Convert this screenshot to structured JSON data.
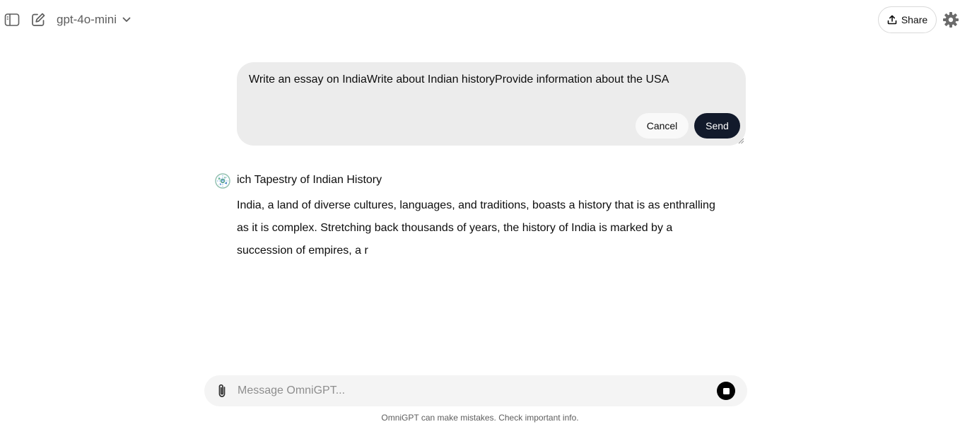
{
  "header": {
    "model_name": "gpt-4o-mini",
    "share_label": "Share"
  },
  "edit": {
    "text": "Write an essay on IndiaWrite about Indian historyProvide information about the USA",
    "cancel_label": "Cancel",
    "send_label": "Send"
  },
  "response": {
    "heading": "ich Tapestry of Indian History",
    "lines": [
      "India, a land of diverse cultures, languages, and traditions, boasts a history that is as enthralling",
      "as it is complex. Stretching back thousands of years, the history of India is marked by a",
      "succession of empires, a r"
    ]
  },
  "composer": {
    "placeholder": "Message OmniGPT..."
  },
  "footer": {
    "disclaimer": "OmniGPT can make mistakes. Check important info."
  },
  "icons": {
    "sidebar_toggle": "sidebar-toggle-icon",
    "new_chat": "new-chat-icon",
    "chevron": "chevron-down-icon",
    "share": "share-upload-icon",
    "settings": "gear-icon",
    "avatar": "assistant-avatar-icon",
    "attach": "paperclip-icon",
    "stop": "stop-icon"
  },
  "colors": {
    "send_button": "#121a2b",
    "edit_box": "#ececec",
    "composer": "#f4f4f4"
  }
}
